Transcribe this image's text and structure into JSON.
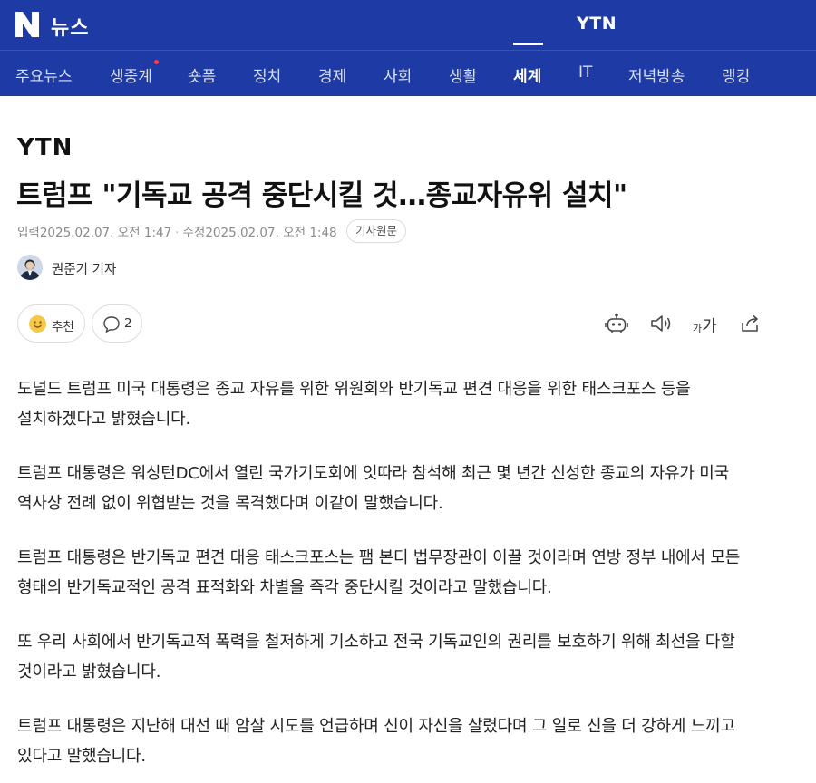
{
  "header": {
    "logo_text": "뉴스",
    "press_name": "YTN",
    "colors": {
      "brand": "#1d3aa5",
      "new_dot": "#ff3b4e"
    }
  },
  "nav": {
    "items": [
      {
        "label": "주요뉴스"
      },
      {
        "label": "생중계",
        "has_new_dot": true
      },
      {
        "label": "숏폼"
      },
      {
        "label": "정치"
      },
      {
        "label": "경제"
      },
      {
        "label": "사회"
      },
      {
        "label": "생활"
      },
      {
        "label": "세계",
        "active": true
      },
      {
        "label": "IT"
      },
      {
        "label": "저녁방송"
      },
      {
        "label": "랭킹"
      }
    ]
  },
  "article": {
    "press_logo": "YTN",
    "title": "트럼프 \"기독교 공격 중단시킬 것…종교자유위 설치\"",
    "meta": {
      "input_label": "입력",
      "input_time": "2025.02.07. 오전 1:47",
      "edit_label": "수정",
      "edit_time": "2025.02.07. 오전 1:48",
      "origin_button": "기사원문"
    },
    "reporter": "권준기 기자",
    "reactions": {
      "like_label": "추천",
      "comment_count": "2"
    },
    "toolbar": {
      "font_small": "가",
      "font_large": "가"
    },
    "paragraphs": [
      "도널드 트럼프 미국 대통령은 종교 자유를 위한 위원회와 반기독교 편견 대응을 위한 태스크포스 등을 설치하겠다고 밝혔습니다.",
      "트럼프 대통령은 워싱턴DC에서 열린 국가기도회에 잇따라 참석해 최근 몇 년간 신성한 종교의 자유가 미국 역사상 전례 없이 위협받는 것을 목격했다며 이같이 말했습니다.",
      "트럼프 대통령은 반기독교 편견 대응 태스크포스는 팸 본디 법무장관이 이끌 것이라며 연방 정부 내에서 모든 형태의 반기독교적인 공격 표적화와 차별을 즉각 중단시킬 것이라고 말했습니다.",
      "또 우리 사회에서 반기독교적 폭력을 철저하게 기소하고 전국 기독교인의 권리를 보호하기 위해 최선을 다할 것이라고 밝혔습니다.",
      "트럼프 대통령은 지난해 대선 때 암살 시도를 언급하며 신이 자신을 살렸다며 그 일로 신을 더 강하게 느끼고 있다고 말했습니다."
    ]
  }
}
